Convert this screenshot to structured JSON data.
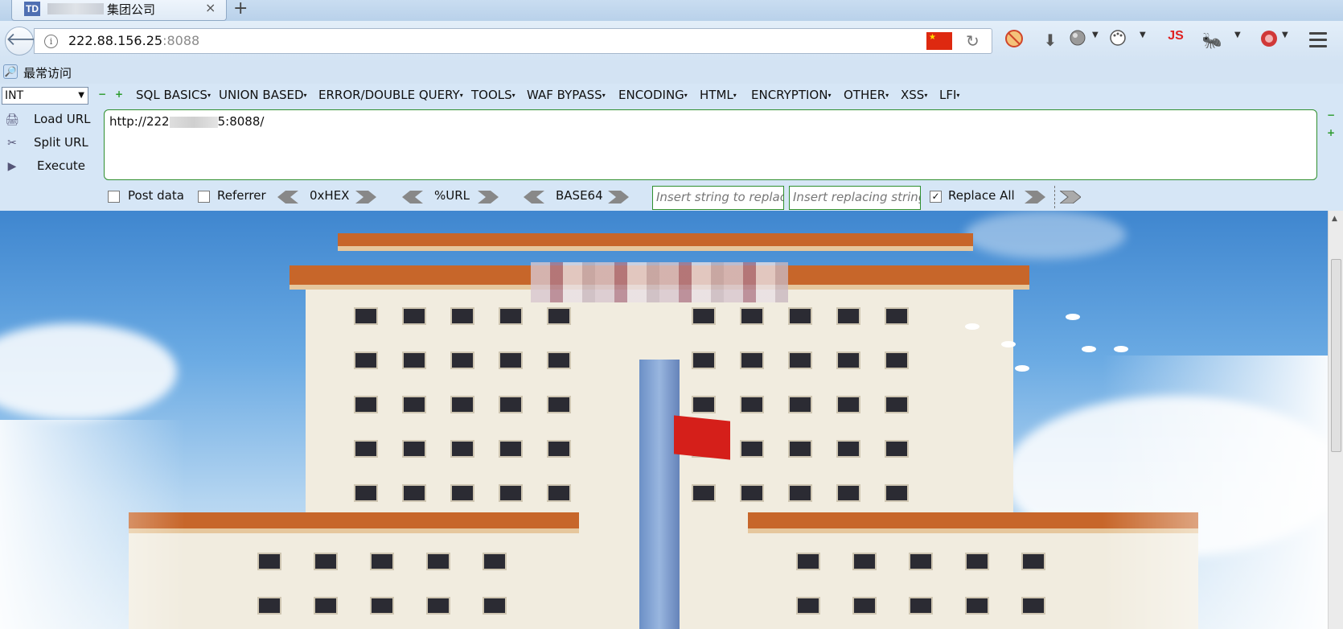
{
  "tab": {
    "favicon_text": "TD",
    "title": "集团公司",
    "close": "×",
    "new_tab": "+"
  },
  "nav": {
    "url_host": "222.88.156.25",
    "url_port": ":8088",
    "icons": [
      "back-arrow-icon",
      "info-icon",
      "china-flag-icon",
      "reload-icon",
      "no-script-icon",
      "download-icon",
      "globe-icon",
      "palette-icon",
      "js-icon",
      "bug-icon",
      "shield-icon",
      "hamburger-menu-icon"
    ],
    "js_label": "JS"
  },
  "bookmarks": {
    "most_visited": "最常访问"
  },
  "hackbar": {
    "encoding_select": "INT",
    "minus": "−",
    "plus": "+",
    "menus": [
      "SQL BASICS",
      "UNION BASED",
      "ERROR/DOUBLE QUERY",
      "TOOLS",
      "WAF BYPASS",
      "ENCODING",
      "HTML",
      "ENCRYPTION",
      "OTHER",
      "XSS",
      "LFI"
    ],
    "actions": {
      "load_url": "Load URL",
      "split_url": "Split URL",
      "execute": "Execute"
    },
    "url_prefix": "http://222",
    "url_suffix": "5:8088/",
    "post_data": "Post data",
    "referrer": "Referrer",
    "hex": "0xHEX",
    "url_enc": "%URL",
    "base64": "BASE64",
    "replace_from_placeholder": "Insert string to replac",
    "replace_to_placeholder": "Insert replacing string",
    "replace_all": "Replace All",
    "replace_all_checked": "✓"
  }
}
